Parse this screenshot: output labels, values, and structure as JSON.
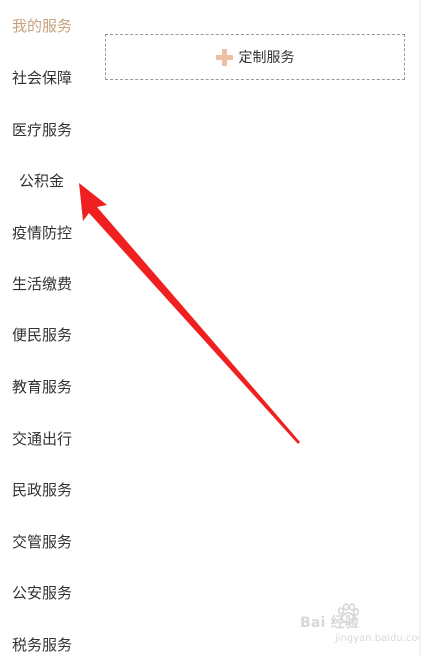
{
  "sidebar": {
    "items": [
      {
        "label": "我的服务",
        "active": true
      },
      {
        "label": "社会保障"
      },
      {
        "label": "医疗服务"
      },
      {
        "label": "公积金"
      },
      {
        "label": "疫情防控"
      },
      {
        "label": "生活缴费"
      },
      {
        "label": "便民服务"
      },
      {
        "label": "教育服务"
      },
      {
        "label": "交通出行"
      },
      {
        "label": "民政服务"
      },
      {
        "label": "交管服务"
      },
      {
        "label": "公安服务"
      },
      {
        "label": "税务服务"
      }
    ]
  },
  "main": {
    "custom_service": {
      "label": "定制服务",
      "icon": "plus-icon"
    }
  },
  "annotation": {
    "arrow_color": "#f02020",
    "target": "公积金"
  },
  "watermark": {
    "main": "Bai 经验",
    "sub": "jingyan.baidu.com"
  },
  "colors": {
    "active_text": "#c8a27f",
    "plus_icon": "#ecc1a3",
    "text": "#333333"
  }
}
